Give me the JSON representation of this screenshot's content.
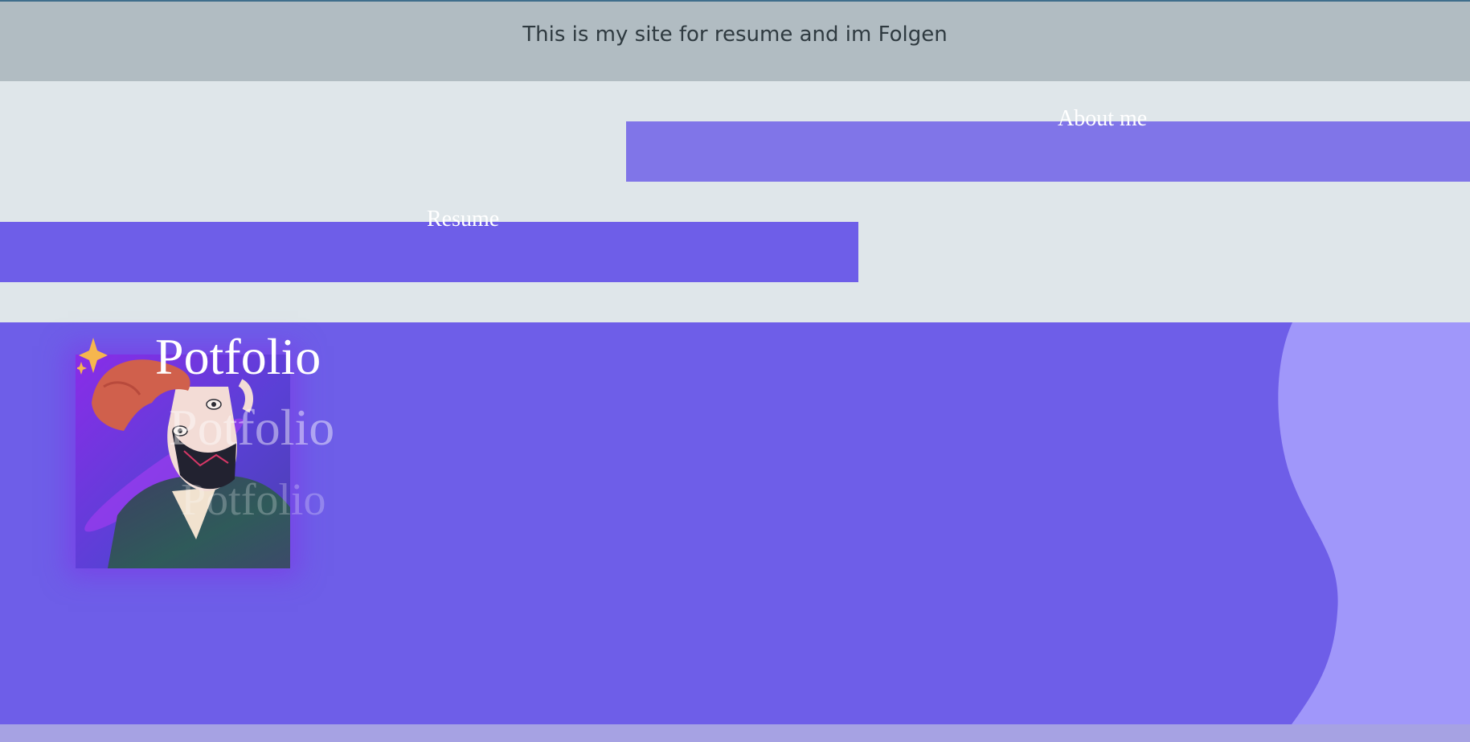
{
  "header": {
    "text": "This is my site for resume and im Folgen"
  },
  "nav": {
    "about_label": "About me",
    "resume_label": "Resume"
  },
  "hero": {
    "title": "Potfolio"
  },
  "colors": {
    "top_bar": "#b1bcc2",
    "page_bg": "#dfe6ea",
    "about_bar": "#8075e8",
    "resume_bar": "#6e5ee8",
    "hero_bg": "#6e5ee8",
    "wave": "#a097fa",
    "sparkle": "#f6b64e"
  },
  "icons": {
    "sparkle": "sparkle-icon",
    "avatar": "avatar-illustration"
  }
}
